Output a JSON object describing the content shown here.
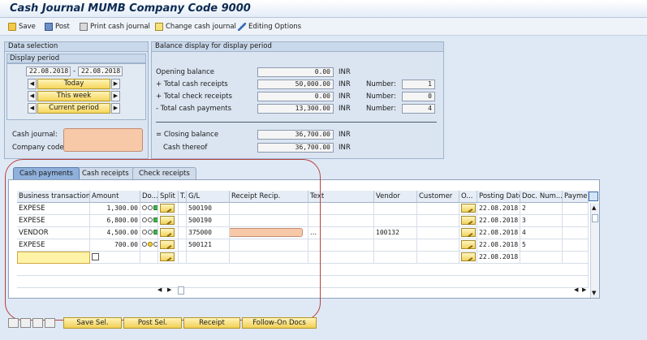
{
  "window": {
    "title": "Cash Journal MUMB Company Code 9000"
  },
  "toolbar": {
    "save": "Save",
    "post": "Post",
    "print": "Print cash journal",
    "change": "Change cash journal",
    "editing": "Editing Options"
  },
  "data_selection": {
    "header": "Data selection",
    "display_period": "Display period",
    "date_from": "22.08.2018",
    "date_sep": "-",
    "date_to": "22.08.2018",
    "today": "Today",
    "this_week": "This week",
    "current_period": "Current period",
    "cash_journal_label": "Cash journal:",
    "company_code_label": "Company code:"
  },
  "balance": {
    "header": "Balance display for display period",
    "opening_label": "Opening balance",
    "opening_value": "0.00",
    "cash_receipts_label": "+ Total cash receipts",
    "cash_receipts_value": "50,000.00",
    "cash_receipts_number": "1",
    "check_receipts_label": "+ Total check receipts",
    "check_receipts_value": "0.00",
    "check_receipts_number": "0",
    "cash_payments_label": "- Total cash payments",
    "cash_payments_value": "13,300.00",
    "cash_payments_number": "4",
    "closing_label": "= Closing balance",
    "closing_value": "36,700.00",
    "cash_thereof_label": "Cash thereof",
    "cash_thereof_value": "36,700.00",
    "currency": "INR",
    "number_label": "Number:"
  },
  "tabs": [
    "Cash payments",
    "Cash receipts",
    "Check receipts"
  ],
  "grid": {
    "headers": [
      "Business transaction",
      "Amount",
      "Do...",
      "Split",
      "T..",
      "G/L",
      "Receipt Recip.",
      "Text",
      "Vendor",
      "Customer",
      "O...",
      "Posting Date",
      "Doc. Num...",
      "Paymer"
    ],
    "rows": [
      {
        "tx": "EXPESE",
        "amount": "1,300.00",
        "gl": "500190",
        "vendor": "",
        "date": "22.08.2018",
        "doc": "2"
      },
      {
        "tx": "EXPESE",
        "amount": "6,800.00",
        "gl": "500190",
        "vendor": "",
        "date": "22.08.2018",
        "doc": "3"
      },
      {
        "tx": "VENDOR",
        "amount": "4,500.00",
        "gl": "375000",
        "vendor": "100132",
        "date": "22.08.2018",
        "doc": "4"
      },
      {
        "tx": "EXPESE",
        "amount": "700.00",
        "gl": "500121",
        "vendor": "",
        "date": "22.08.2018",
        "doc": "5"
      },
      {
        "tx": "",
        "amount": "",
        "gl": "",
        "vendor": "",
        "date": "22.08.2018",
        "doc": ""
      }
    ],
    "text_dots": "..."
  },
  "bottom": {
    "save_sel": "Save Sel.",
    "post_sel": "Post Sel.",
    "receipt": "Receipt",
    "follow_on": "Follow-On Docs"
  }
}
